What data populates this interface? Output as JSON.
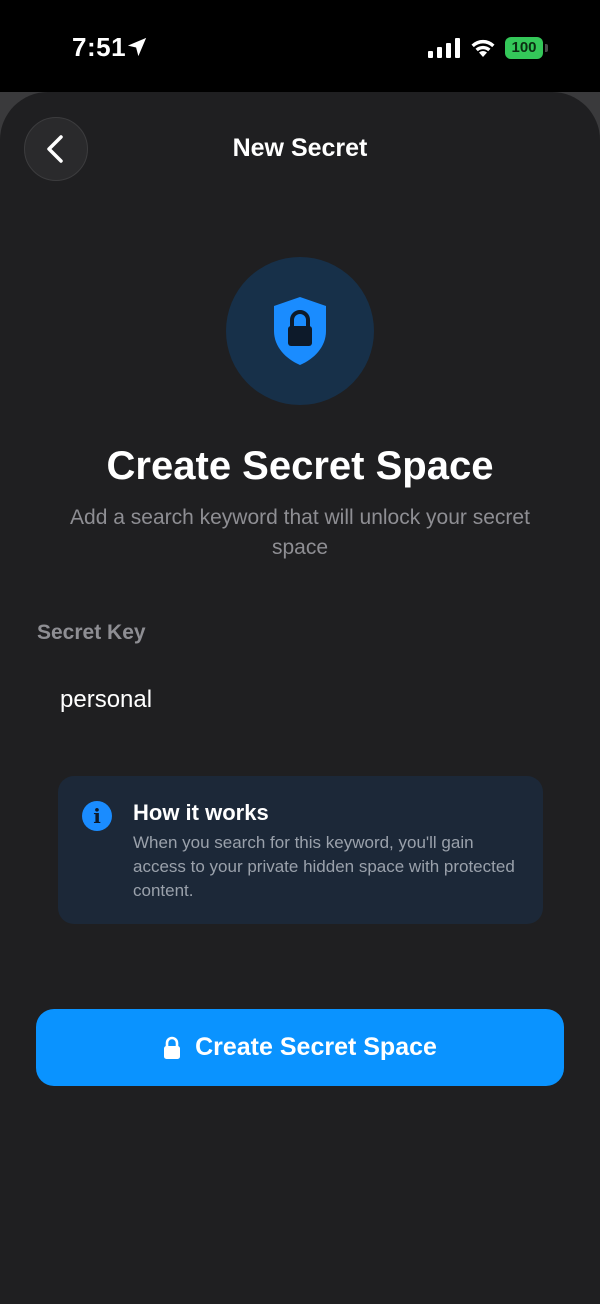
{
  "status_bar": {
    "time": "7:51",
    "battery": "100",
    "icons": [
      "location-arrow-icon",
      "cellular-signal-icon",
      "wifi-icon",
      "battery-icon"
    ],
    "battery_color": "#34c759"
  },
  "nav": {
    "title": "New Secret",
    "back_icon": "chevron-left-icon"
  },
  "hero": {
    "icon": "shield-lock-icon",
    "accent": "#1a8cff"
  },
  "content": {
    "heading": "Create Secret Space",
    "subheading": "Add a search keyword that will unlock your secret space"
  },
  "field": {
    "label": "Secret Key",
    "value": "personal"
  },
  "info_card": {
    "icon": "info-icon",
    "title": "How it works",
    "body": "When you search for this keyword, you'll gain access to your private hidden space with protected content."
  },
  "primary_button": {
    "icon": "lock-icon",
    "label": "Create Secret Space",
    "color": "#0a93ff"
  }
}
